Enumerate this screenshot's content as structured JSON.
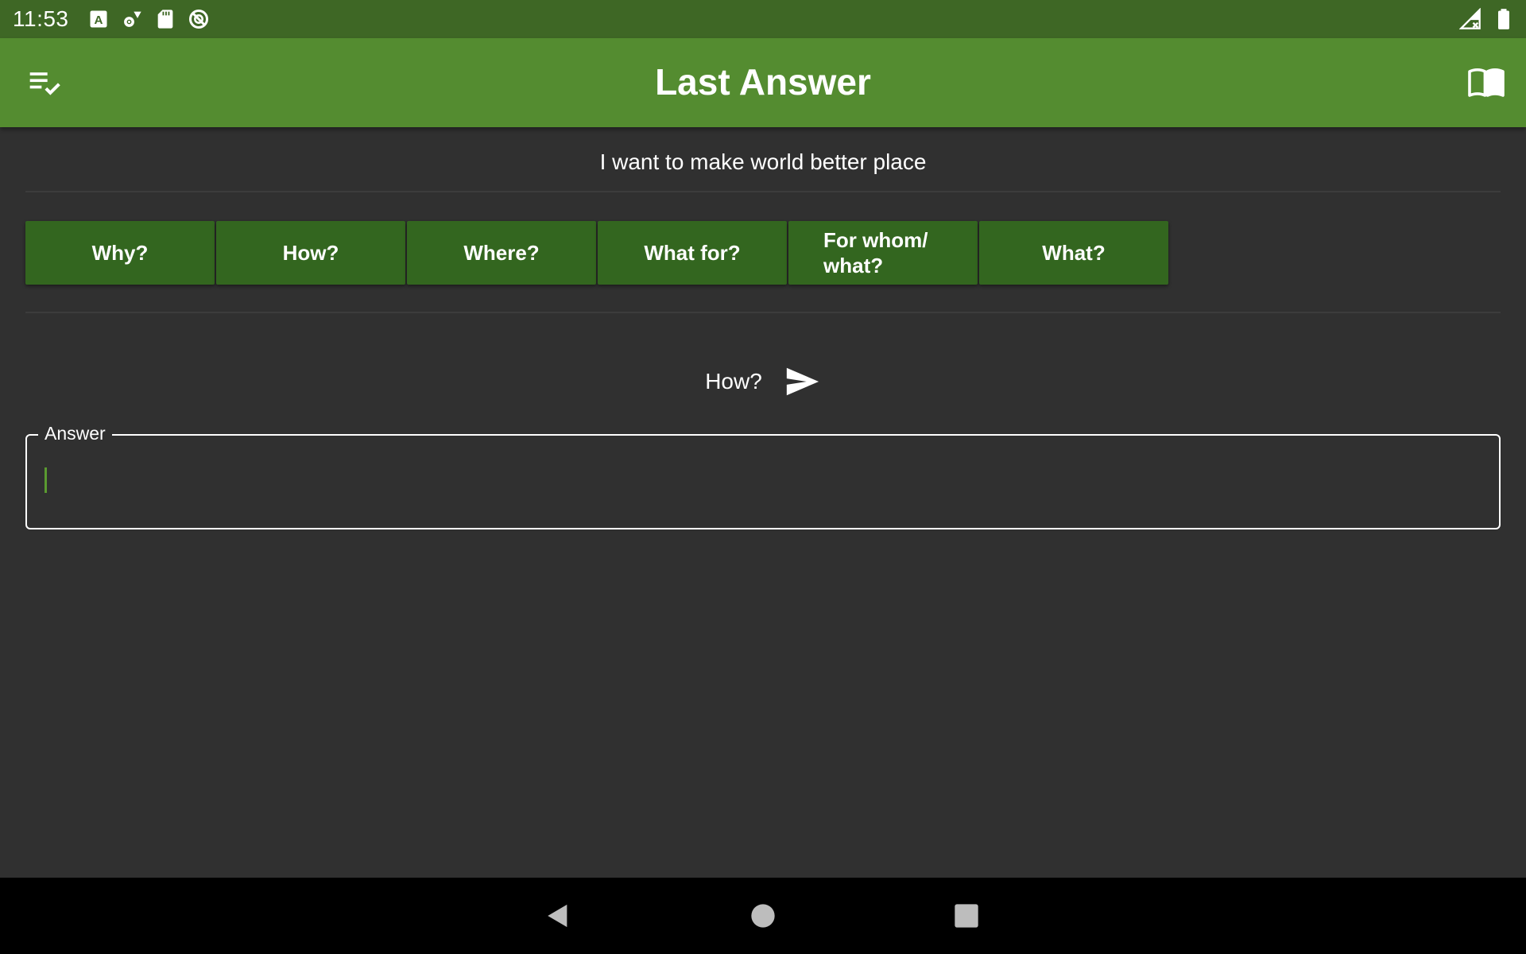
{
  "status_bar": {
    "time": "11:53",
    "left_icons": [
      "font-a-icon",
      "wifi-settings-icon",
      "sd-card-icon",
      "sync-off-icon"
    ],
    "right_icons": [
      "no-signal-icon",
      "battery-icon"
    ]
  },
  "app_bar": {
    "title": "Last Answer",
    "left_icon": "playlist-check-icon",
    "right_icon": "book-open-icon"
  },
  "statement": "I want to make world better place",
  "question_buttons": [
    {
      "label": "Why?"
    },
    {
      "label": "How?"
    },
    {
      "label": "Where?"
    },
    {
      "label": "What for?"
    },
    {
      "label": "For whom/ what?"
    },
    {
      "label": "What?"
    }
  ],
  "current_question": {
    "label": "How?",
    "send_icon": "send-icon"
  },
  "answer_field": {
    "label": "Answer",
    "value": ""
  },
  "nav_bar": {
    "buttons": [
      "back-icon",
      "home-icon",
      "recent-apps-icon"
    ]
  },
  "colors": {
    "status_bar": "#3e6725",
    "app_bar": "#548c30",
    "button": "#33661f",
    "background": "#303030",
    "caret": "#5a9a30"
  }
}
